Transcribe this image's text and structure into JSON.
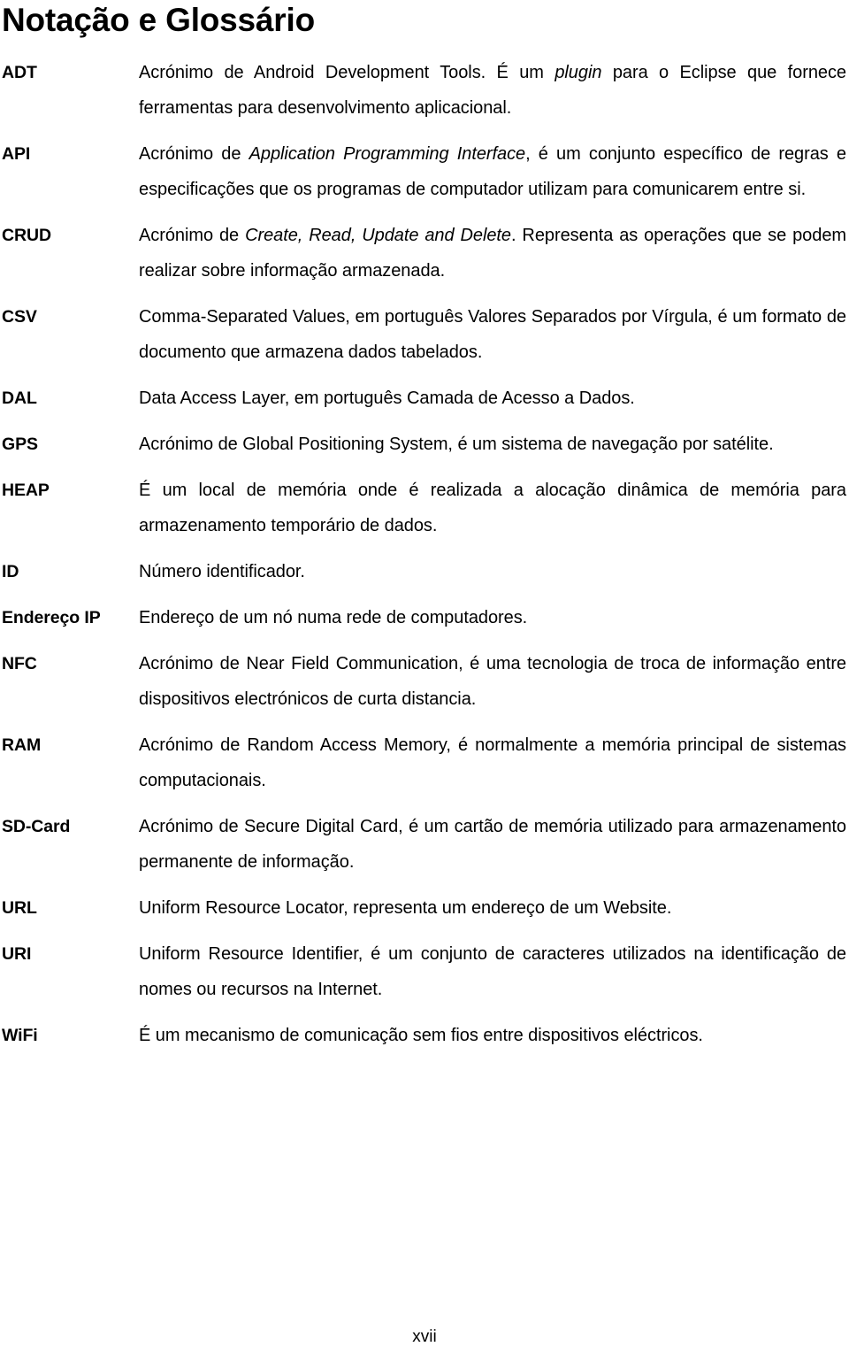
{
  "document": {
    "title": "Notação e Glossário",
    "page_number": "xvii"
  },
  "glossary": {
    "entries": [
      {
        "term": "ADT",
        "definition_parts": [
          {
            "text": "Acrónimo de Android Development Tools. É um ",
            "style": "normal"
          },
          {
            "text": "plugin",
            "style": "italic"
          },
          {
            "text": " para o Eclipse que fornece ferramentas para desenvolvimento aplicacional.",
            "style": "normal"
          }
        ],
        "definition_plain": "Acrónimo de Android Development Tools. É um plugin para o Eclipse que fornece ferramentas para desenvolvimento aplicacional.",
        "justified": true
      },
      {
        "term": "API",
        "definition_parts": [
          {
            "text": "Acrónimo de ",
            "style": "normal"
          },
          {
            "text": "Application Programming Interface",
            "style": "italic"
          },
          {
            "text": ", é um conjunto específico de regras e especificações que os programas de computador utilizam para comunicarem entre si.",
            "style": "normal"
          }
        ],
        "definition_plain": "Acrónimo de Application Programming Interface, é um conjunto específico de regras e especificações que os programas de computador utilizam para comunicarem entre si.",
        "justified": true
      },
      {
        "term": "CRUD",
        "definition_parts": [
          {
            "text": "Acrónimo de ",
            "style": "normal"
          },
          {
            "text": "Create, Read, Update and Delete",
            "style": "italic"
          },
          {
            "text": ". Representa as operações que se podem realizar sobre informação armazenada.",
            "style": "normal"
          }
        ],
        "definition_plain": "Acrónimo de Create, Read, Update and Delete. Representa as operações que se podem realizar sobre informação armazenada.",
        "justified": true
      },
      {
        "term": "CSV",
        "definition_parts": [
          {
            "text": "Comma-Separated Values, em português Valores Separados por Vírgula, é um formato de documento que armazena dados tabelados.",
            "style": "normal"
          }
        ],
        "definition_plain": "Comma-Separated Values, em português Valores Separados por Vírgula, é um formato de documento que armazena dados tabelados.",
        "justified": true
      },
      {
        "term": "DAL",
        "definition_parts": [
          {
            "text": "Data Access Layer, em português Camada de Acesso a Dados.",
            "style": "normal"
          }
        ],
        "definition_plain": "Data Access Layer, em português Camada de Acesso a Dados.",
        "justified": false
      },
      {
        "term": "GPS",
        "definition_parts": [
          {
            "text": "Acrónimo de Global Positioning System, é um sistema de navegação por satélite.",
            "style": "normal"
          }
        ],
        "definition_plain": "Acrónimo de Global Positioning System, é um sistema de navegação por satélite.",
        "justified": true
      },
      {
        "term": "HEAP",
        "definition_parts": [
          {
            "text": "É um local de memória onde é realizada a alocação dinâmica de memória para armazenamento temporário de dados.",
            "style": "normal"
          }
        ],
        "definition_plain": "É um local de memória onde é realizada a alocação dinâmica de memória para armazenamento temporário de dados.",
        "justified": true
      },
      {
        "term": "ID",
        "definition_parts": [
          {
            "text": "Número identificador.",
            "style": "normal"
          }
        ],
        "definition_plain": "Número identificador.",
        "justified": false
      },
      {
        "term": "Endereço IP",
        "definition_parts": [
          {
            "text": "Endereço de um nó numa rede de computadores.",
            "style": "normal"
          }
        ],
        "definition_plain": "Endereço de um nó numa rede de computadores.",
        "justified": false
      },
      {
        "term": "NFC",
        "definition_parts": [
          {
            "text": "Acrónimo de Near Field Communication, é uma tecnologia de troca de informação entre dispositivos electrónicos de curta distancia.",
            "style": "normal"
          }
        ],
        "definition_plain": "Acrónimo de Near Field Communication, é uma tecnologia de troca de informação entre dispositivos electrónicos de curta distancia.",
        "justified": true
      },
      {
        "term": "RAM",
        "definition_parts": [
          {
            "text": "Acrónimo de Random Access Memory, é normalmente a memória principal de sistemas computacionais.",
            "style": "normal"
          }
        ],
        "definition_plain": "Acrónimo de Random Access Memory, é normalmente a memória principal de sistemas computacionais.",
        "justified": true
      },
      {
        "term": "SD-Card",
        "definition_parts": [
          {
            "text": "Acrónimo de Secure Digital Card, é um cartão de memória utilizado para armazenamento permanente de informação.",
            "style": "normal"
          }
        ],
        "definition_plain": "Acrónimo de Secure Digital Card, é um cartão de memória utilizado para armazenamento permanente de informação.",
        "justified": true
      },
      {
        "term": "URL",
        "definition_parts": [
          {
            "text": "Uniform Resource Locator, representa um endereço de um Website.",
            "style": "normal"
          }
        ],
        "definition_plain": "Uniform Resource Locator, representa um endereço de um Website.",
        "justified": false
      },
      {
        "term": "URI",
        "definition_parts": [
          {
            "text": "Uniform Resource Identifier, é um conjunto de caracteres utilizados na identificação de nomes ou recursos na Internet.",
            "style": "normal"
          }
        ],
        "definition_plain": "Uniform Resource Identifier, é um conjunto de caracteres utilizados na identificação de nomes ou recursos na Internet.",
        "justified": true
      },
      {
        "term": "WiFi",
        "definition_parts": [
          {
            "text": "É um mecanismo de comunicação sem fios entre dispositivos eléctricos.",
            "style": "normal"
          }
        ],
        "definition_plain": "É um mecanismo de comunicação sem fios entre dispositivos eléctricos.",
        "justified": false
      }
    ]
  }
}
